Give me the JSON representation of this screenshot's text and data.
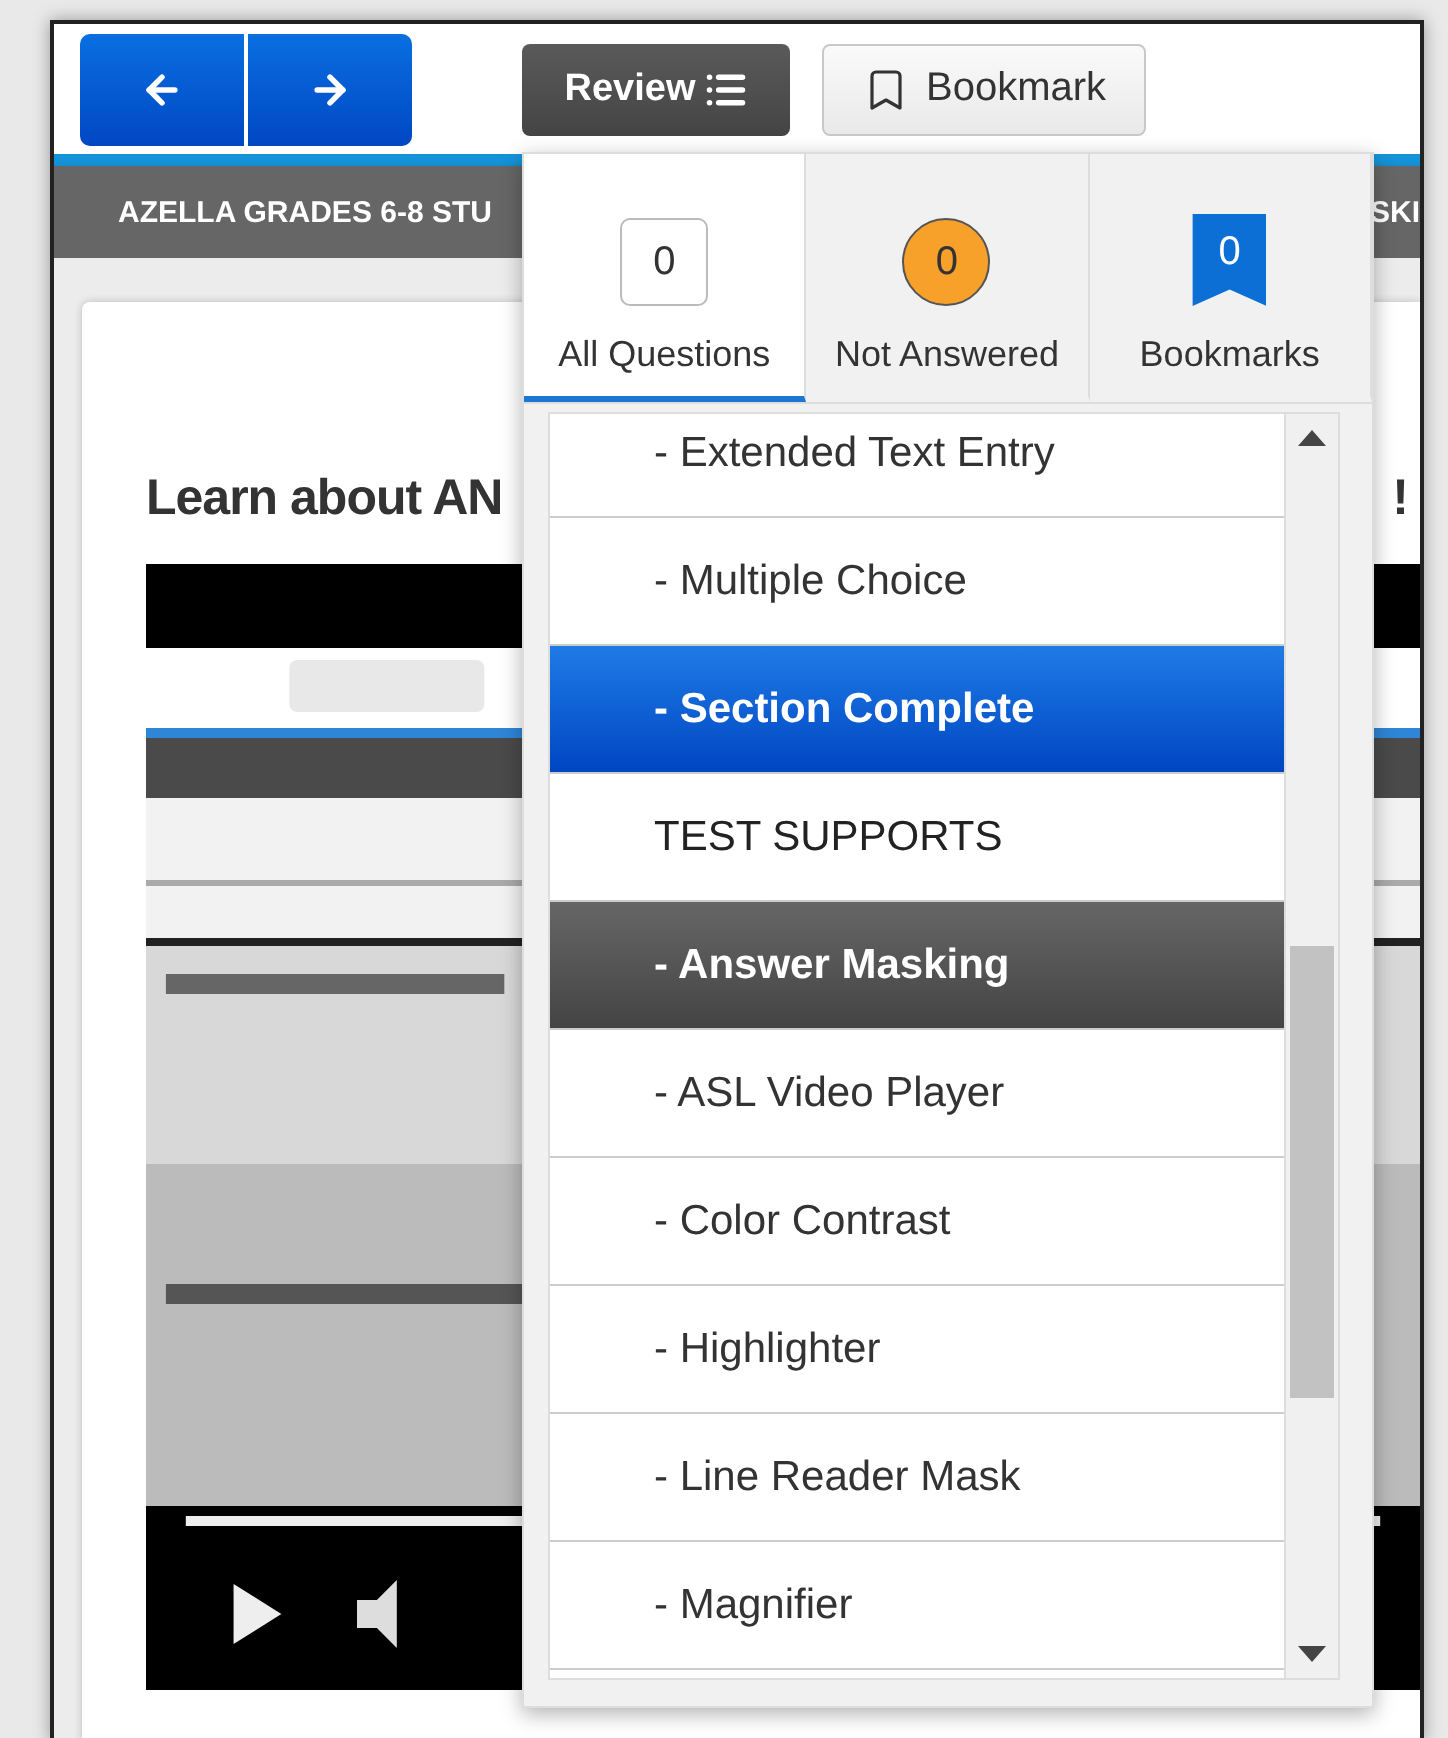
{
  "nav": {
    "buttons": [
      {
        "kind": "back"
      },
      {
        "kind": "forward"
      }
    ]
  },
  "toolbar": {
    "review": {
      "label": "Review"
    },
    "bookmark": {
      "label": "Bookmark"
    }
  },
  "banner": {
    "title": "AZELLA GRADES 6-8 STU",
    "right_text": "SKI"
  },
  "content": {
    "heading": "Learn about AN",
    "heading_end": "!"
  },
  "review_panel": {
    "tabs": [
      {
        "label": "All Questions",
        "count": "0",
        "kind": "box",
        "selected": true
      },
      {
        "label": "Not Answered",
        "count": "0",
        "kind": "circle",
        "selected": false
      },
      {
        "label": "Bookmarks",
        "count": "0",
        "kind": "bookmark",
        "selected": false
      }
    ],
    "items": [
      {
        "label": "- Extended Text Entry",
        "kind": "item",
        "selected": false,
        "focused": false
      },
      {
        "label": "- Multiple Choice",
        "kind": "item",
        "selected": false,
        "focused": false
      },
      {
        "label": "- Section Complete",
        "kind": "item",
        "selected": true,
        "focused": false
      },
      {
        "label": "TEST SUPPORTS",
        "kind": "header",
        "selected": false,
        "focused": false
      },
      {
        "label": "- Answer Masking",
        "kind": "item",
        "selected": false,
        "focused": true
      },
      {
        "label": "- ASL Video Player",
        "kind": "item",
        "selected": false,
        "focused": false
      },
      {
        "label": "- Color Contrast",
        "kind": "item",
        "selected": false,
        "focused": false
      },
      {
        "label": "- Highlighter",
        "kind": "item",
        "selected": false,
        "focused": false
      },
      {
        "label": "- Line Reader Mask",
        "kind": "item",
        "selected": false,
        "focused": false
      },
      {
        "label": "- Magnifier",
        "kind": "item",
        "selected": false,
        "focused": false
      }
    ]
  }
}
